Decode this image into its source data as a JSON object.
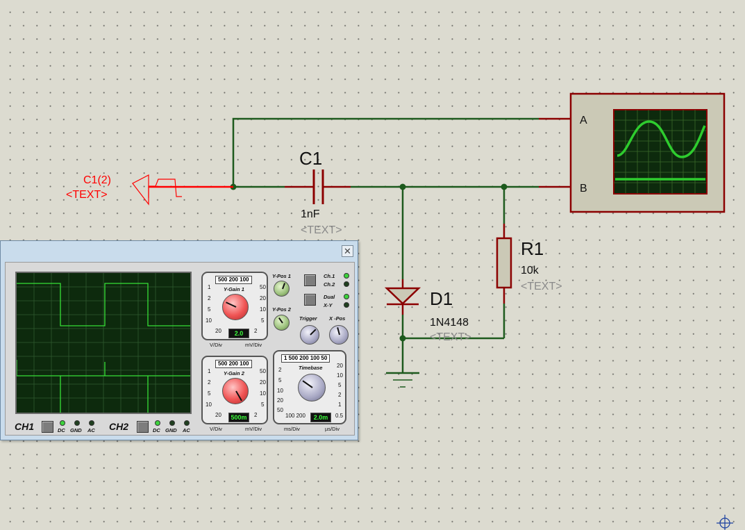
{
  "generator": {
    "ref": "C1(2)",
    "text": "<TEXT>"
  },
  "capacitor": {
    "ref": "C1",
    "value": "1nF",
    "text": "<TEXT>"
  },
  "resistor": {
    "ref": "R1",
    "value": "10k",
    "text": "<TEXT>"
  },
  "diode": {
    "ref": "D1",
    "value": "1N4148",
    "text": "<TEXT>"
  },
  "scope_symbol": {
    "pin_a": "A",
    "pin_b": "B"
  },
  "colors": {
    "wire": "#1d5a1d",
    "component": "#8b0000",
    "probe_wire": "#ff0000",
    "scope_trace": "#2ecc2e",
    "hidden_text": "#8a8a8a"
  },
  "oscilloscope_panel": {
    "close_icon": "✕",
    "ygain1": {
      "title": "Y-Gain 1",
      "scale_top": "500 200 100",
      "left_scale": [
        "1",
        "2",
        "5",
        "10",
        "20"
      ],
      "right_scale": [
        "50",
        "20",
        "10",
        "5",
        "2"
      ],
      "left_unit": "V/Div",
      "right_unit": "mV/Div",
      "display": "2.0"
    },
    "ygain2": {
      "title": "Y-Gain 2",
      "scale_top": "500 200 100",
      "left_scale": [
        "1",
        "2",
        "5",
        "10",
        "20"
      ],
      "right_scale": [
        "50",
        "20",
        "10",
        "5",
        "2"
      ],
      "left_unit": "V/Div",
      "right_unit": "mV/Div",
      "display": "500m"
    },
    "ypos1": "Y-Pos 1",
    "ypos2": "Y-Pos 2",
    "trigger": "Trigger",
    "xpos": "X -Pos",
    "mode": {
      "ch1": "Ch.1",
      "ch2": "Ch.2",
      "dual": "Dual",
      "xy": "X-Y"
    },
    "timebase": {
      "title": "Timebase",
      "scale_top": "1  500 200 100 50",
      "left_scale": [
        "2",
        "5",
        "10",
        "20",
        "50"
      ],
      "right_scale": [
        "20",
        "10",
        "5",
        "2",
        "1",
        "0.5"
      ],
      "bottom_left": "100 200",
      "display": "2.0m",
      "left_unit": "ms/Div",
      "right_unit": "µs/Div"
    },
    "ch1": {
      "label": "CH1",
      "dc": "DC",
      "gnd": "GND",
      "ac": "AC"
    },
    "ch2": {
      "label": "CH2",
      "dc": "DC",
      "gnd": "GND",
      "ac": "AC"
    }
  }
}
